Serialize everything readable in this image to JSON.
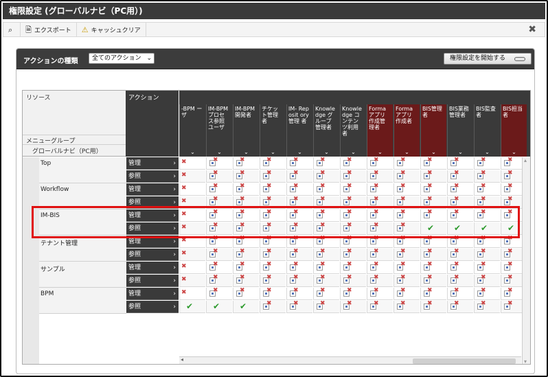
{
  "window": {
    "title": "権限設定 (グローバルナビ（PC用）)"
  },
  "toolbar": {
    "search_icon": "search-icon",
    "export_label": "エクスポート",
    "cache_label": "キャッシュクリア",
    "close_icon": "close-icon"
  },
  "panel": {
    "action_type_label": "アクションの種類",
    "action_select_value": "全てのアクション",
    "start_button_label": "権限設定を開始する"
  },
  "grid": {
    "resource_label": "リソース",
    "action_label": "アクション",
    "menu_group_label": "メニューグループ",
    "global_nav_label": "グローバルナビ（PC用）",
    "columns": [
      {
        "label": "-BPM ーザ",
        "red": false
      },
      {
        "label": "IM-BPM プロセ ス参照 ユーザ",
        "red": false
      },
      {
        "label": "IM-BPM 開発者",
        "red": false
      },
      {
        "label": "チケッ ト管理 者",
        "red": false
      },
      {
        "label": "IM- Reposit ory 管理 者",
        "red": false
      },
      {
        "label": "Knowle dge グ ループ 管理者",
        "red": false
      },
      {
        "label": "Knowle dge コ ンテン ツ利用 者",
        "red": false
      },
      {
        "label": "Forma アプリ 作成管 理者",
        "red": true
      },
      {
        "label": "Forma アプリ 作成者",
        "red": true
      },
      {
        "label": "BIS管理 者",
        "red": true
      },
      {
        "label": "BIS業務 管理者",
        "red": false
      },
      {
        "label": "BIS監査 者",
        "red": false
      },
      {
        "label": "BIS担当 者",
        "red": true
      }
    ],
    "groups": [
      {
        "name": "Top",
        "actions": [
          "管理",
          "参照"
        ],
        "allow": [
          [],
          []
        ]
      },
      {
        "name": "Workflow",
        "actions": [
          "管理",
          "参照"
        ],
        "allow": [
          [],
          []
        ]
      },
      {
        "name": "IM-BIS",
        "actions": [
          "管理",
          "参照"
        ],
        "allow": [
          [],
          [
            9,
            10,
            11,
            12
          ]
        ]
      },
      {
        "name": "テナント管理",
        "actions": [
          "管理",
          "参照"
        ],
        "allow": [
          [],
          []
        ]
      },
      {
        "name": "サンプル",
        "actions": [
          "管理",
          "参照"
        ],
        "allow": [
          [],
          []
        ]
      },
      {
        "name": "BPM",
        "actions": [
          "管理",
          "参照"
        ],
        "allow": [
          [],
          [
            0,
            1,
            2
          ]
        ]
      }
    ]
  },
  "colors": {
    "highlight": "#e01010",
    "allow": "#2d9a2d",
    "deny": "#cc4444",
    "header_dark": "#3a3a3a",
    "header_red": "#6b1a1a"
  }
}
